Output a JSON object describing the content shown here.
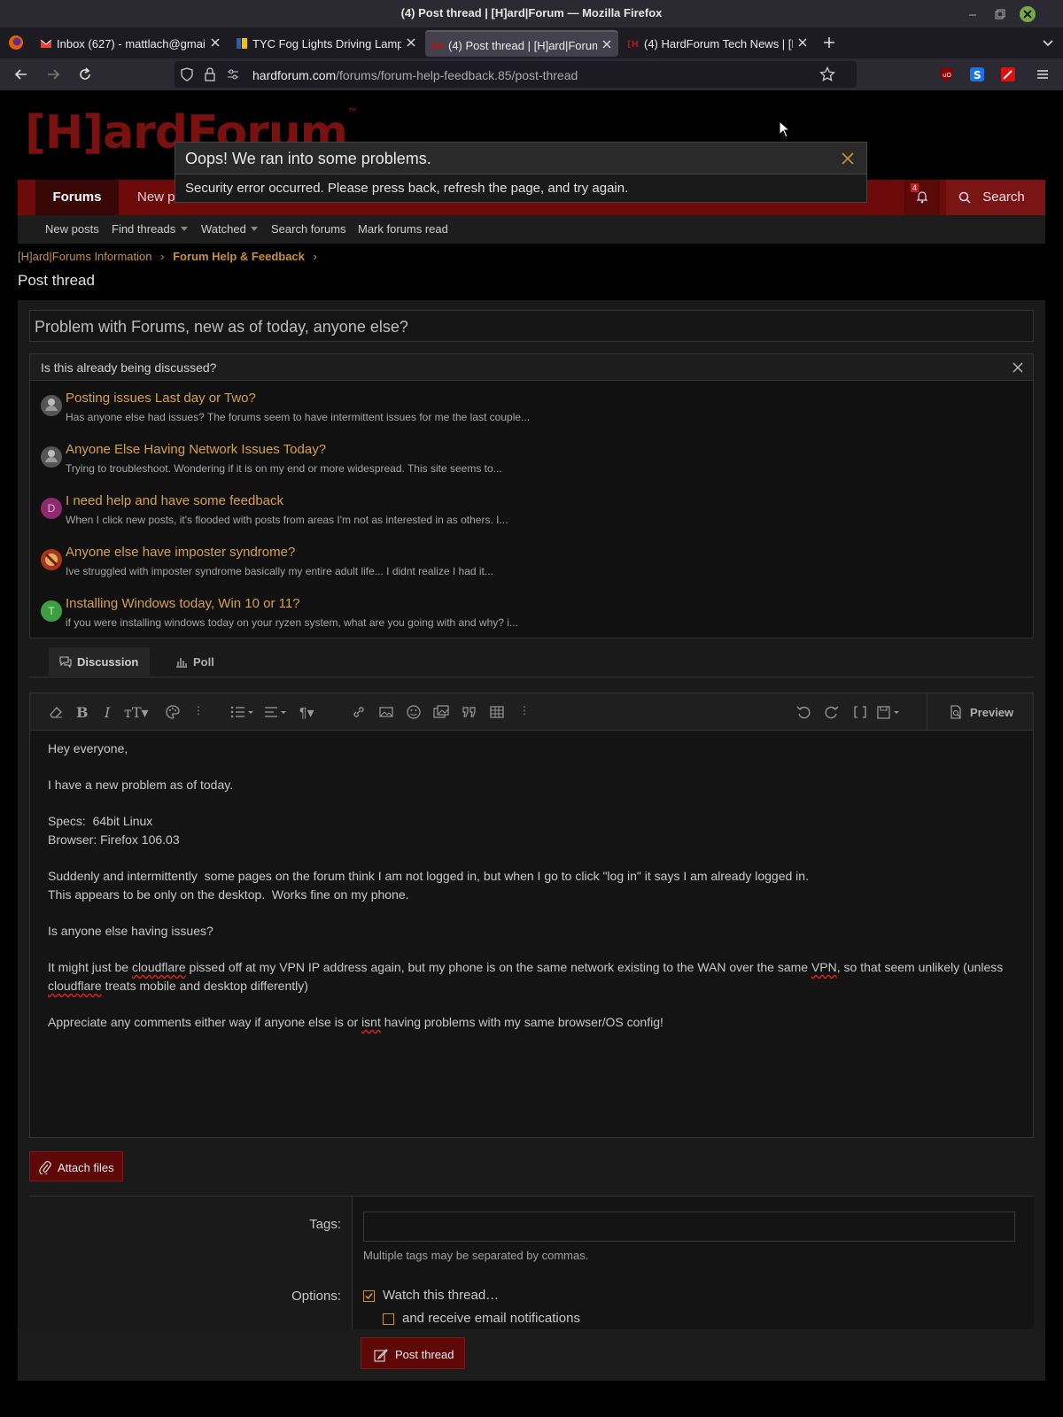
{
  "window": {
    "title": "(4) Post thread | [H]ard|Forum — Mozilla Firefox"
  },
  "tabs": [
    {
      "label": "Inbox (627) - mattlach@gmai",
      "favicon": "gmail-icon"
    },
    {
      "label": "TYC Fog Lights Driving Lamp",
      "favicon": "shop-icon"
    },
    {
      "label": "(4) Post thread | [H]ard|Forum",
      "favicon": "hardforum-icon",
      "active": true
    },
    {
      "label": "(4) HardForum Tech News | [H",
      "favicon": "hardforum-icon"
    }
  ],
  "urlbar": {
    "host": "hardforum.com",
    "path": "/forums/forum-help-feedback.85/post-thread"
  },
  "site": {
    "logo": "[H]ardForum",
    "logo_tm": "™",
    "nav": {
      "forums": "Forums",
      "new_posts": "New po",
      "alert_count": "4",
      "search": "Search"
    },
    "subnav": [
      "New posts",
      "Find threads",
      "Watched",
      "Search forums",
      "Mark forums read"
    ]
  },
  "breadcrumb": {
    "root": "[H]ard|Forums Information",
    "current": "Forum Help & Feedback",
    "sep": "›"
  },
  "page_title": "Post thread",
  "thread_title_value": "Problem with Forums, new as of today, anyone else?",
  "similar": {
    "heading": "Is this already being discussed?",
    "items": [
      {
        "title": "Posting issues Last day or Two?",
        "snippet": "Has anyone else had issues? The forums seem to have intermittent issues for me the last couple...",
        "avatar": "",
        "avatar_color": "#555555"
      },
      {
        "title": "Anyone Else Having Network Issues Today?",
        "snippet": "Trying to troubleshoot. Wondering if it is on my end or more widespread. This site seems to...",
        "avatar": "",
        "avatar_color": "#555555"
      },
      {
        "title": "I need help and have some feedback",
        "snippet": "When I click new posts, it's flooded with posts from areas I'm not as interested in as others. I...",
        "avatar": "D",
        "avatar_color": "#8e2a6e"
      },
      {
        "title": "Anyone else have imposter syndrome?",
        "snippet": "Ive struggled with imposter syndrome basically my entire adult life... I didnt realize I had it...",
        "avatar": "",
        "avatar_color": "#a8351e"
      },
      {
        "title": "Installing Windows today, Win 10 or 11?",
        "snippet": "if you were installing windows today on your ryzen system, what are you going with and why? i...",
        "avatar": "T",
        "avatar_color": "#3f9e3f"
      }
    ]
  },
  "editor_tabs": {
    "discussion": "Discussion",
    "poll": "Poll"
  },
  "editor": {
    "preview": "Preview",
    "body": {
      "l1": "Hey everyone,",
      "l2": "I have a new problem as of today.",
      "l3a": "Specs:  64bit Linux",
      "l3b": "Browser: Firefox 106.03",
      "l4a": "Suddenly and intermittently  some pages on the forum think I am not logged in, but when I go to click \"log in\" it says I am already logged in.",
      "l4b": "This appears to be only on the desktop.  Works fine on my phone.",
      "l5": "Is anyone else having issues?",
      "l6a": "It might just be ",
      "l6b": "cloudflare",
      "l6c": " pissed off at my VPN IP address again, but my phone is on the same network existing to the WAN over the same ",
      "l6d": "VPN",
      "l6e": ", so that seem unlikely (unless ",
      "l6f": "cloudflare",
      "l6g": " treats mobile and desktop differently)",
      "l7a": "Appreciate any comments either way if anyone else is or ",
      "l7b": "isnt",
      "l7c": " having problems with my same browser/OS config!"
    }
  },
  "attach_files": "Attach files",
  "tags": {
    "label": "Tags:",
    "value": "",
    "hint": "Multiple tags may be separated by commas."
  },
  "options": {
    "label": "Options:",
    "watch": {
      "label": "Watch this thread…",
      "checked": true
    },
    "email": {
      "label": "and receive email notifications",
      "checked": false
    }
  },
  "post_button": "Post thread",
  "error": {
    "title": "Oops! We ran into some problems.",
    "message": "Security error occurred. Please press back, refresh the page, and try again."
  },
  "colors": {
    "brand_red": "#6d0b0b",
    "link_gold": "#d6a04a",
    "background": "#000000"
  }
}
